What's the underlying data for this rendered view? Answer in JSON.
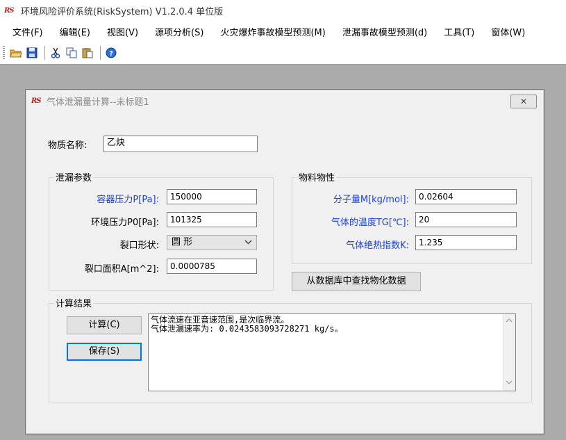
{
  "app": {
    "logo": "RS",
    "title": "环境风险评价系统(RiskSystem) V1.2.0.4 单位版"
  },
  "menu": [
    "文件(F)",
    "编辑(E)",
    "视图(V)",
    "源项分析(S)",
    "火灾爆炸事故模型预测(M)",
    "泄漏事故模型预测(d)",
    "工具(T)",
    "窗体(W)"
  ],
  "toolbar_icons": [
    "open-folder-icon",
    "save-disk-icon",
    "cut-scissors-icon",
    "copy-icon",
    "paste-icon",
    "help-icon"
  ],
  "dialog": {
    "logo": "RS",
    "title": "气体泄漏量计算--未标题1",
    "close": "✕",
    "substance": {
      "label": "物质名称:",
      "value": "乙炔"
    },
    "leak_group": {
      "title": "泄漏参数",
      "pressure_label": "容器压力P[Pa]:",
      "pressure_value": "150000",
      "ambient_label": "环境压力P0[Pa]:",
      "ambient_value": "101325",
      "shape_label": "裂口形状:",
      "shape_value": "圆  形",
      "area_label": "裂口面积A[m^2]:",
      "area_value": "0.0000785"
    },
    "material_group": {
      "title": "物料物性",
      "mw_label": "分子量M[kg/mol]:",
      "mw_value": "0.02604",
      "temp_label": "气体的温度TG[℃]:",
      "temp_value": "20",
      "k_label": "气体绝热指数K:",
      "k_value": "1.235",
      "lookup_button": "从数据库中查找物化数据"
    },
    "result_group": {
      "title": "计算结果",
      "calc_button": "计算(C)",
      "save_button": "保存(S)",
      "line1": "气体流速在亚音速范围,是次临界流。",
      "line2": "气体泄漏速率为: 0.0243583093728271 kg/s。"
    }
  },
  "colors": {
    "label_blue": "#1a3fd6",
    "workspace": "#ababab",
    "dialog_bg": "#f0f0f0",
    "logo_red": "#b81d1d"
  }
}
